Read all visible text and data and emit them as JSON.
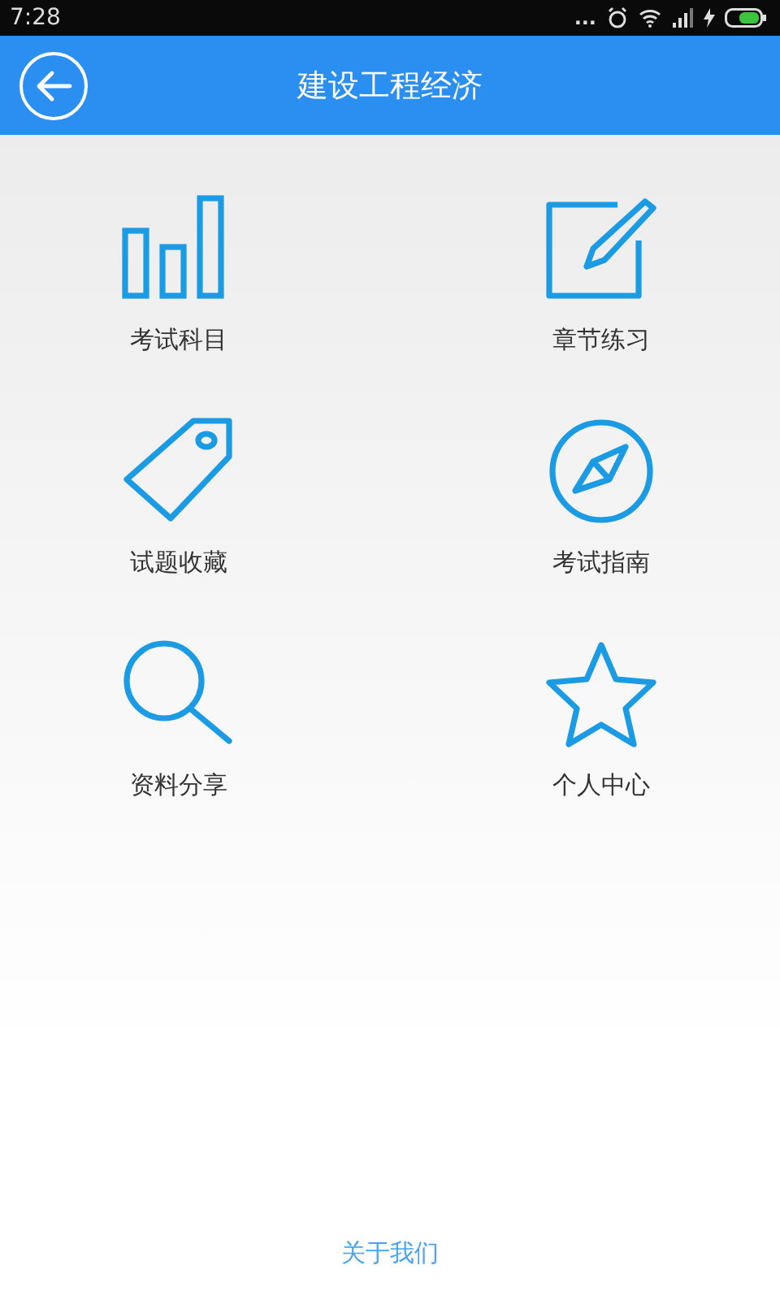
{
  "status_bar": {
    "time": "7:28",
    "overflow": "..."
  },
  "header": {
    "title": "建设工程经济"
  },
  "menu": [
    {
      "kind": "bars",
      "label": "考试科目"
    },
    {
      "kind": "edit",
      "label": "章节练习"
    },
    {
      "kind": "tag",
      "label": "试题收藏"
    },
    {
      "kind": "compass",
      "label": "考试指南"
    },
    {
      "kind": "search",
      "label": "资料分享"
    },
    {
      "kind": "star",
      "label": "个人中心"
    }
  ],
  "footer": {
    "link": "关于我们"
  }
}
